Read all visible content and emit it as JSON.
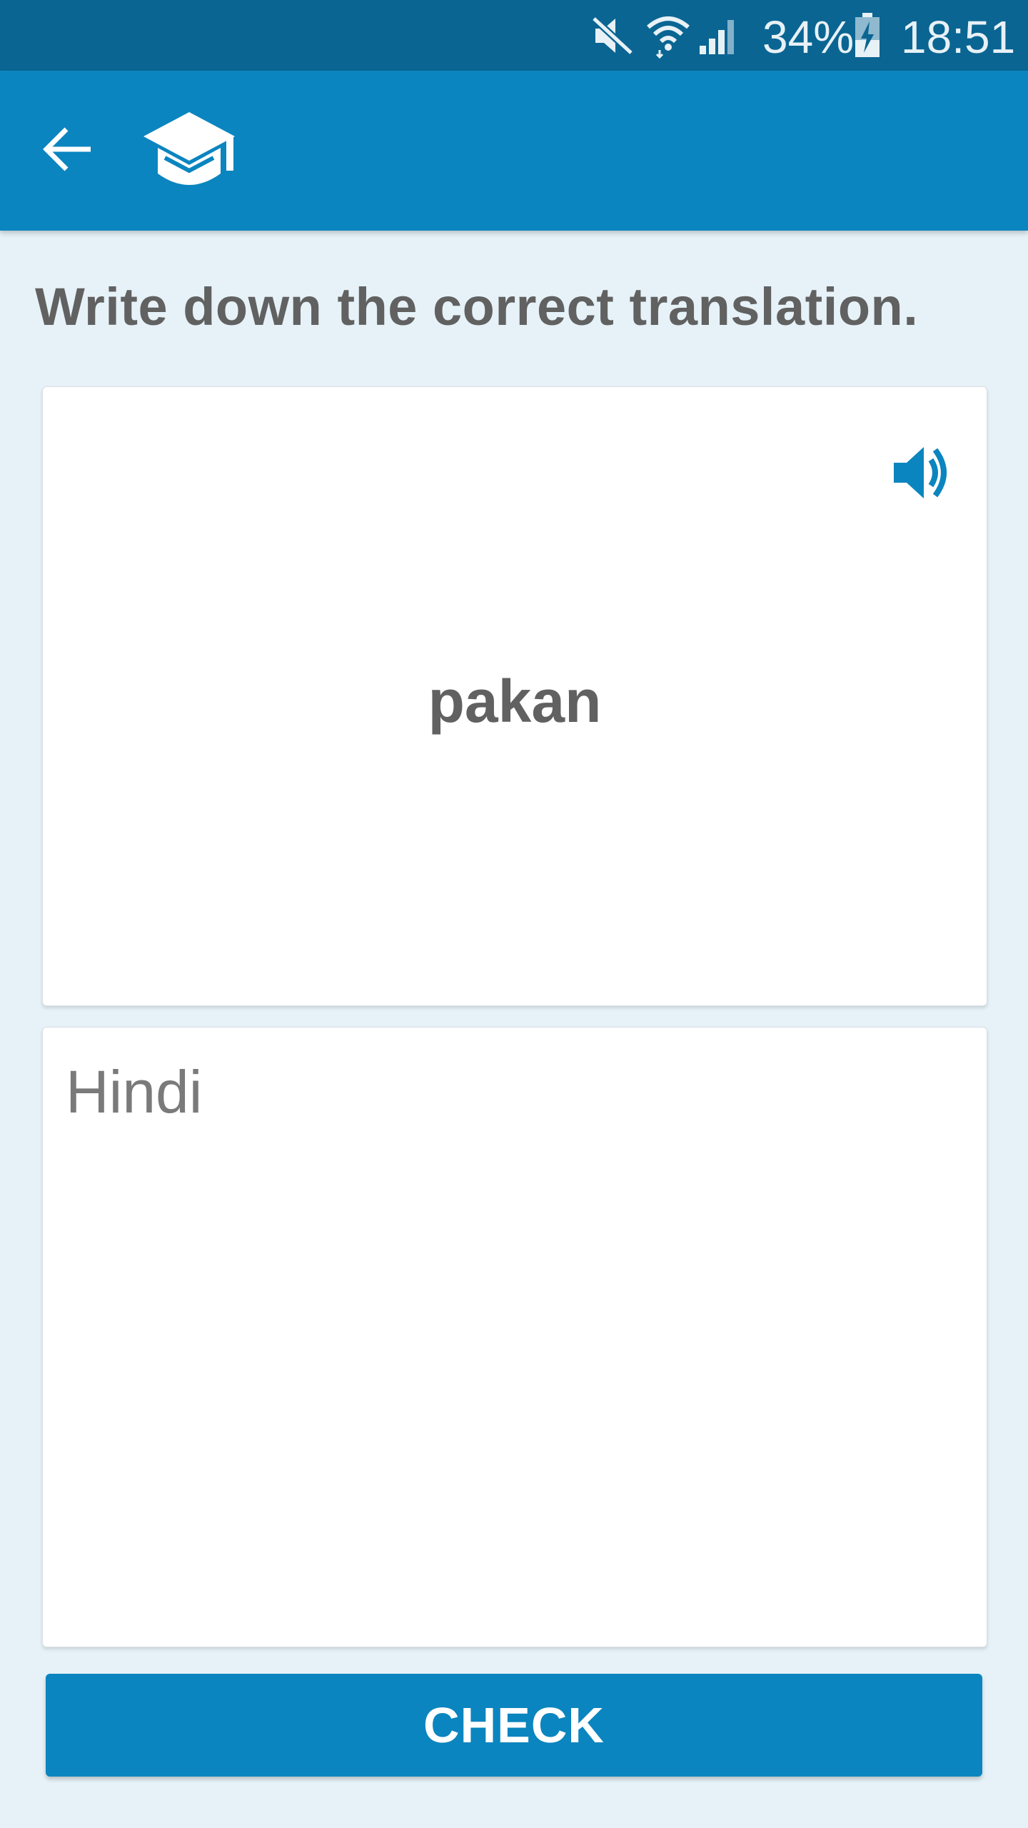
{
  "status_bar": {
    "battery_percent": "34%",
    "time": "18:51",
    "icons": [
      "mute-icon",
      "wifi-icon",
      "signal-icon",
      "battery-charging-icon"
    ]
  },
  "toolbar": {
    "back_icon": "arrow-left-icon",
    "logo_icon": "graduation-cap-icon"
  },
  "exercise": {
    "instruction": "Write down the correct translation.",
    "word": "pakan",
    "speaker_icon": "speaker-icon",
    "answer_placeholder": "Hindi",
    "answer_value": "",
    "check_label": "CHECK"
  },
  "colors": {
    "status_bar": "#0a6592",
    "primary": "#0b85bf",
    "background": "#e6f2f8",
    "text": "#616161"
  }
}
